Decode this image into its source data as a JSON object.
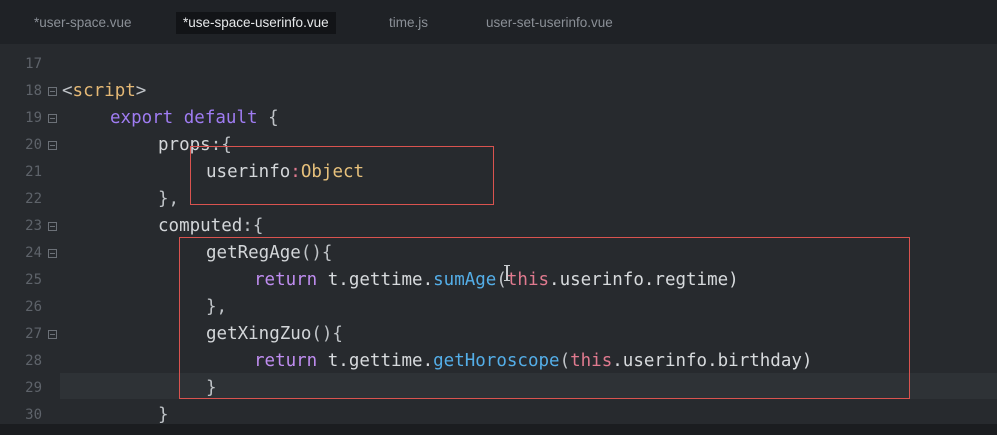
{
  "tabs": [
    {
      "label": "*user-space.vue",
      "active": false
    },
    {
      "label": "*use-space-userinfo.vue",
      "active": true
    },
    {
      "label": "time.js",
      "active": false
    },
    {
      "label": "user-set-userinfo.vue",
      "active": false
    }
  ],
  "editor": {
    "line_numbers": [
      "17",
      "18",
      "19",
      "20",
      "21",
      "22",
      "23",
      "24",
      "25",
      "26",
      "27",
      "28",
      "29",
      "30"
    ],
    "lines": {
      "l18": {
        "open": "<",
        "tag": "script",
        "close": ">"
      },
      "l19": {
        "kw1": "export",
        "kw2": "default",
        "punc": " {"
      },
      "l20": {
        "name": "props",
        "punc": ":{"
      },
      "l21": {
        "name": "userinfo",
        "colon": ":",
        "type": "Object"
      },
      "l22": {
        "punc": "},"
      },
      "l23": {
        "name": "computed",
        "punc": ":{"
      },
      "l24": {
        "name": "getRegAge",
        "punc": "(){"
      },
      "l25": {
        "kw": "return",
        "obj": "t.gettime.",
        "fn": "sumAge",
        "open": "(",
        "this": "this",
        "rest": ".userinfo.regtime)"
      },
      "l26": {
        "punc": "},"
      },
      "l27": {
        "name": "getXingZuo",
        "punc": "(){"
      },
      "l28": {
        "kw": "return",
        "obj": "t.gettime.",
        "fn": "getHoroscope",
        "open": "(",
        "this": "this",
        "rest": ".userinfo.birthday)"
      },
      "l29": {
        "punc": "}"
      },
      "l30": {
        "punc": "}"
      }
    }
  },
  "colors": {
    "keyword": "#9f7cf2",
    "function": "#54aee8",
    "this": "#e07a8f",
    "type": "#e6c07b",
    "tag": "#e4b875",
    "annotation_box": "#d9534f"
  }
}
